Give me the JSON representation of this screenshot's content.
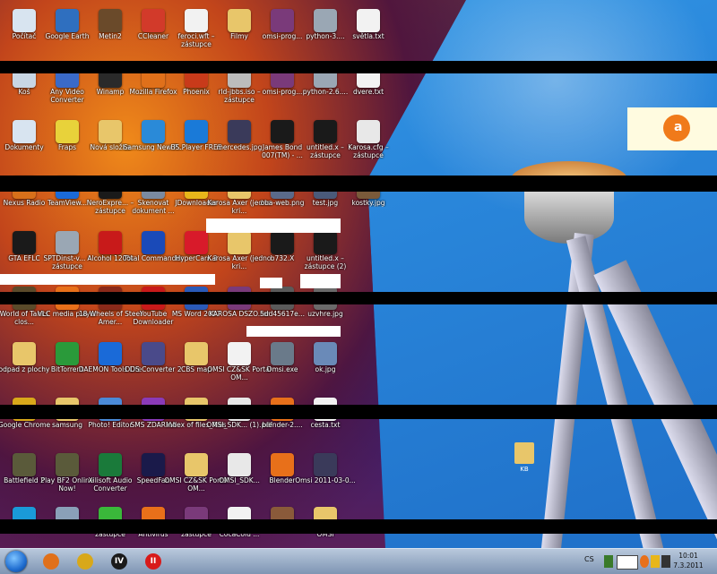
{
  "desktop": {
    "icons": [
      {
        "label": "Počítač",
        "icon": "computer-icon",
        "color": "#d8e4f0"
      },
      {
        "label": "Google Earth",
        "icon": "globe-icon",
        "color": "#2f6fbf"
      },
      {
        "label": "Metin2",
        "icon": "game-icon",
        "color": "#6a4a2a"
      },
      {
        "label": "CCleaner",
        "icon": "ccleaner-icon",
        "color": "#d23a2a"
      },
      {
        "label": "feroci.wft – zástupce",
        "icon": "file-icon",
        "color": "#f2f2f2"
      },
      {
        "label": "Filmy",
        "icon": "folder-icon",
        "color": "#e8c66a"
      },
      {
        "label": "omsi-prog...",
        "icon": "archive-icon",
        "color": "#7a3a7a"
      },
      {
        "label": "python-3....",
        "icon": "installer-icon",
        "color": "#9aa7b4"
      },
      {
        "label": "světla.txt",
        "icon": "text-file-icon",
        "color": "#f2f2f2"
      },
      {
        "label": "Koš",
        "icon": "recycle-bin-icon",
        "color": "#c8d6e4"
      },
      {
        "label": "Any Video Converter",
        "icon": "video-converter-icon",
        "color": "#3a6ac8"
      },
      {
        "label": "Winamp",
        "icon": "winamp-icon",
        "color": "#2a2a2a"
      },
      {
        "label": "Mozilla Firefox",
        "icon": "firefox-icon",
        "color": "#e0701a"
      },
      {
        "label": "Phoenix",
        "icon": "phoenix-icon",
        "color": "#c83a1a"
      },
      {
        "label": "rld-jbbs.iso – zástupce",
        "icon": "disc-icon",
        "color": "#bcbcbc"
      },
      {
        "label": "omsi-prog...",
        "icon": "archive-icon",
        "color": "#7a3a7a"
      },
      {
        "label": "python-2.6....",
        "icon": "installer-icon",
        "color": "#9aa7b4"
      },
      {
        "label": "dvere.txt",
        "icon": "text-file-icon",
        "color": "#f2f2f2"
      },
      {
        "label": "Dokumenty",
        "icon": "documents-icon",
        "color": "#d8e4f0"
      },
      {
        "label": "Fraps",
        "icon": "fraps-icon",
        "color": "#e8d23a"
      },
      {
        "label": "Nová složka",
        "icon": "folder-icon",
        "color": "#e8c66a"
      },
      {
        "label": "Samsung New P...",
        "icon": "samsung-icon",
        "color": "#2a8ad8"
      },
      {
        "label": "BS.Player FREE",
        "icon": "bsplayer-icon",
        "color": "#1a7ad8"
      },
      {
        "label": "mercedes.jpg",
        "icon": "image-icon",
        "color": "#3a3a5a"
      },
      {
        "label": "James Bond 007(TM) - ...",
        "icon": "bond-icon",
        "color": "#1a1a1a"
      },
      {
        "label": "untitled.x – zástupce",
        "icon": "3d-icon",
        "color": "#1a1a1a"
      },
      {
        "label": "Karosa.cfg – zástupce",
        "icon": "cfg-file-icon",
        "color": "#e8e8e8"
      },
      {
        "label": "Nexus Radio",
        "icon": "radio-icon",
        "color": "#d8701a"
      },
      {
        "label": "TeamView...",
        "icon": "teamviewer-icon",
        "color": "#1a6ad8"
      },
      {
        "label": "NeroExpre... – zástupce",
        "icon": "nero-icon",
        "color": "#1a1a1a"
      },
      {
        "label": "Skenovat dokument ...",
        "icon": "scanner-icon",
        "color": "#7a8aa0"
      },
      {
        "label": "JDownloader",
        "icon": "jdownloader-icon",
        "color": "#e8b61a"
      },
      {
        "label": "Karosa Axer (jedno kri...",
        "icon": "folder-icon",
        "color": "#e8c66a"
      },
      {
        "label": "oba-web.png",
        "icon": "image-icon",
        "color": "#5a6a8a"
      },
      {
        "label": "test.jpg",
        "icon": "image-icon",
        "color": "#4a5a7a"
      },
      {
        "label": "kostky.jpg",
        "icon": "image-icon",
        "color": "#7a5a3a"
      },
      {
        "label": "GTA EFLC",
        "icon": "gta-icon",
        "color": "#1a1a1a"
      },
      {
        "label": "SPTDinst-v... – zástupce",
        "icon": "installer-icon",
        "color": "#9aa7b4"
      },
      {
        "label": "Alcohol 120%",
        "icon": "alcohol-icon",
        "color": "#c81a1a"
      },
      {
        "label": "Total Commander",
        "icon": "total-commander-icon",
        "color": "#1a4ab8"
      },
      {
        "label": "HyperCam 3",
        "icon": "hypercam-icon",
        "color": "#d81a2a"
      },
      {
        "label": "Karosa Axer (jedno kri...",
        "icon": "folder-icon",
        "color": "#e8c66a"
      },
      {
        "label": "b732.X",
        "icon": "3d-icon",
        "color": "#1a1a1a"
      },
      {
        "label": "untitled.x – zástupce (2)",
        "icon": "3d-icon",
        "color": "#1a1a1a"
      },
      {
        "label": "World of Tanks clos...",
        "icon": "tank-icon",
        "color": "#5a4a2a"
      },
      {
        "label": "VLC media player",
        "icon": "vlc-icon",
        "color": "#e8701a"
      },
      {
        "label": "18 Wheels of Steel Amer...",
        "icon": "truck-icon",
        "color": "#8a2a1a"
      },
      {
        "label": "YouTube Downloader",
        "icon": "youtube-icon",
        "color": "#c81a1a"
      },
      {
        "label": "MS Word 2007",
        "icon": "word-icon",
        "color": "#2a5ab8"
      },
      {
        "label": "KAROSA DSZO.rar",
        "icon": "archive-icon",
        "color": "#7a3a7a"
      },
      {
        "label": "5dd45617e...",
        "icon": "image-icon",
        "color": "#5a5a5a"
      },
      {
        "label": "uzvhre.jpg",
        "icon": "image-icon",
        "color": "#6a6a6a"
      },
      {
        "label": "odpad z plochy",
        "icon": "folder-icon",
        "color": "#e8c66a"
      },
      {
        "label": "BitTorrent",
        "icon": "bittorrent-icon",
        "color": "#2a9a3a"
      },
      {
        "label": "DAEMON Tools Lite",
        "icon": "daemon-tools-icon",
        "color": "#1a6ad8"
      },
      {
        "label": "DDS Converter 2",
        "icon": "dds-icon",
        "color": "#4a4a8a"
      },
      {
        "label": "CBS map",
        "icon": "folder-icon",
        "color": "#e8c66a"
      },
      {
        "label": "OMSI CZ&SK Portál OM...",
        "icon": "document-icon",
        "color": "#f2f2f2"
      },
      {
        "label": "Omsi.exe",
        "icon": "omsi-icon",
        "color": "#6a7a8a"
      },
      {
        "label": "ok.jpg",
        "icon": "image-icon",
        "color": "#6a8ab8"
      },
      {
        "label": "Google Chrome",
        "icon": "chrome-icon",
        "color": "#d8a81a"
      },
      {
        "label": "samsung",
        "icon": "folder-icon",
        "color": "#e8c66a"
      },
      {
        "label": "Photo! Editor",
        "icon": "photo-editor-icon",
        "color": "#4a8ad8"
      },
      {
        "label": "SMS ZDARMA",
        "icon": "sms-icon",
        "color": "#8a3ab8"
      },
      {
        "label": "index of files_files",
        "icon": "folder-icon",
        "color": "#e8c66a"
      },
      {
        "label": "OMSI_SDK... (1).pdf",
        "icon": "pdf-icon",
        "color": "#e8e8e8"
      },
      {
        "label": "blender-2....",
        "icon": "blender-icon",
        "color": "#e8701a"
      },
      {
        "label": "cesta.txt",
        "icon": "text-file-icon",
        "color": "#f2f2f2"
      },
      {
        "label": "Battlefield 2",
        "icon": "battlefield-icon",
        "color": "#5a5a3a"
      },
      {
        "label": "Play BF2 Online Now!",
        "icon": "battlefield-icon",
        "color": "#5a5a3a"
      },
      {
        "label": "Xilisoft Audio Converter",
        "icon": "audio-converter-icon",
        "color": "#1a7a3a"
      },
      {
        "label": "SpeedFan",
        "icon": "speedfan-icon",
        "color": "#1a1a4a"
      },
      {
        "label": "OMSI CZ&SK Portál OM...",
        "icon": "folder-icon",
        "color": "#e8c66a"
      },
      {
        "label": "OMSI_SDK...",
        "icon": "pdf-icon",
        "color": "#e8e8e8"
      },
      {
        "label": "Blender",
        "icon": "blender-icon",
        "color": "#e8701a"
      },
      {
        "label": "Omsi 2011-03-0...",
        "icon": "video-icon",
        "color": "#3a3a5a"
      },
      {
        "label": "",
        "icon": "skype-icon",
        "color": "#1a9ad8"
      },
      {
        "label": "",
        "icon": "shortcut-icon",
        "color": "#8aa0b8"
      },
      {
        "label": "zástupce",
        "icon": "icq-icon",
        "color": "#3ab83a"
      },
      {
        "label": "Antivirus",
        "icon": "avast-icon",
        "color": "#e8701a"
      },
      {
        "label": "zástupce",
        "icon": "archive-icon",
        "color": "#7a3a7a"
      },
      {
        "label": "CocaColu ...",
        "icon": "document-icon",
        "color": "#f2f2f2"
      },
      {
        "label": "",
        "icon": "door-icon",
        "color": "#8a5a3a"
      },
      {
        "label": "OMSI",
        "icon": "folder-icon",
        "color": "#e8c66a"
      }
    ],
    "extra_folder": {
      "label": "KB",
      "icon": "folder-icon"
    }
  },
  "avast_badge": {
    "text": "a",
    "icon": "avast-icon"
  },
  "taskbar": {
    "start": {
      "icon": "windows-start-icon"
    },
    "pinned": [
      {
        "icon": "firefox-icon",
        "color": "#e0701a"
      },
      {
        "icon": "chrome-icon",
        "color": "#d8a81a"
      },
      {
        "icon": "gta-icon",
        "color": "#1a1a1a",
        "text": "IV"
      },
      {
        "icon": "pause-icon",
        "color": "#d81a1a",
        "text": "II"
      }
    ],
    "tray": {
      "language": "CS",
      "clock_time": "10:01",
      "clock_date": "7.3.2011"
    }
  },
  "colors": {
    "taskbar": "#8aa0bc",
    "sky": "#2a88dc",
    "stripe": "#000000"
  }
}
